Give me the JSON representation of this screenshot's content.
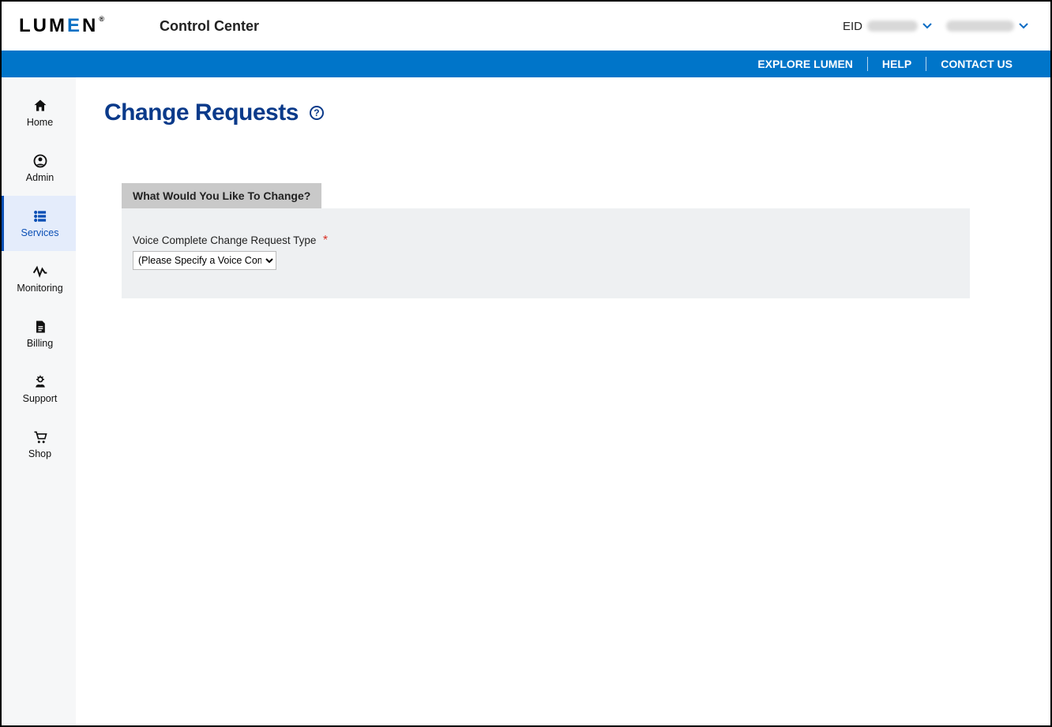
{
  "header": {
    "logo_text": "LUMEN",
    "app_title": "Control Center",
    "eid_label": "EID"
  },
  "nav": {
    "explore": "EXPLORE LUMEN",
    "help": "HELP",
    "contact": "CONTACT US"
  },
  "sidebar": {
    "items": [
      {
        "label": "Home"
      },
      {
        "label": "Admin"
      },
      {
        "label": "Services"
      },
      {
        "label": "Monitoring"
      },
      {
        "label": "Billing"
      },
      {
        "label": "Support"
      },
      {
        "label": "Shop"
      }
    ]
  },
  "page": {
    "title": "Change Requests",
    "help_symbol": "?"
  },
  "panel": {
    "tab_label": "What Would You Like To Change?",
    "field_label": "Voice Complete Change Request Type",
    "required_mark": "*",
    "select_value": "(Please Specify a Voice Com"
  }
}
